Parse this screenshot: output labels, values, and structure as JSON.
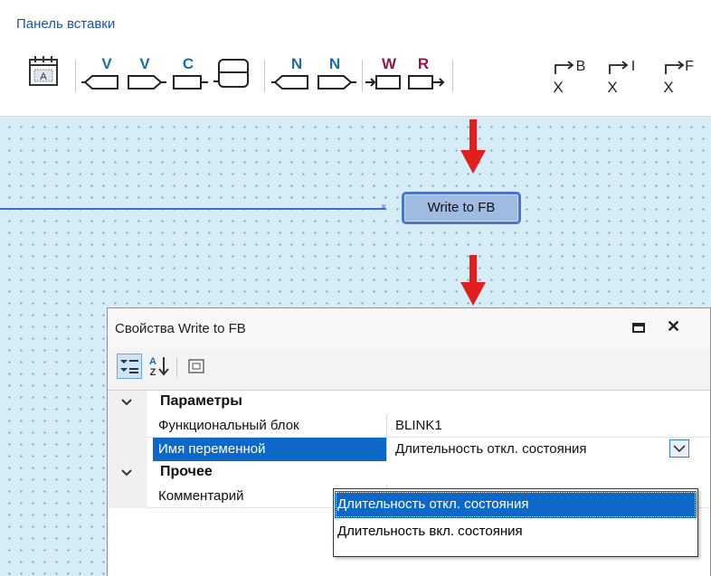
{
  "insert_panel": {
    "title": "Панель вставки",
    "tools": [
      {
        "name": "calendar-block-tool",
        "letter": "A"
      },
      {
        "name": "read-variable-tool",
        "letter": "V"
      },
      {
        "name": "write-variable-tool",
        "letter": "V"
      },
      {
        "name": "constant-tool",
        "letter": "C"
      },
      {
        "name": "connector-tool",
        "letter": ""
      },
      {
        "name": "read-network-tool",
        "letter": "N"
      },
      {
        "name": "write-network-tool",
        "letter": "N"
      },
      {
        "name": "write-fb-tool",
        "letter": "W"
      },
      {
        "name": "read-fb-tool",
        "letter": "R"
      },
      {
        "name": "convert-to-bool-tool",
        "letter": "B"
      },
      {
        "name": "convert-to-int-tool",
        "letter": "I"
      },
      {
        "name": "convert-to-float-tool",
        "letter": "F"
      }
    ]
  },
  "canvas": {
    "node_label": "Write to FB"
  },
  "properties": {
    "title": "Свойства Write to FB",
    "categories": [
      {
        "label": "Параметры"
      },
      {
        "label": "Прочее"
      }
    ],
    "rows": [
      {
        "name": "Функциональный блок",
        "value": "BLINK1"
      },
      {
        "name": "Имя переменной",
        "value": "Длительность откл. состояния"
      },
      {
        "name": "Комментарий",
        "value": ""
      }
    ],
    "dropdown_options": [
      "Длительность откл. состояния",
      "Длительность вкл. состояния"
    ]
  },
  "colors": {
    "accent_blue": "#0e68c8",
    "write_letter": "#8b1a4b",
    "tool_letter": "#1a6fa8",
    "arrow_red": "#e0201f"
  }
}
